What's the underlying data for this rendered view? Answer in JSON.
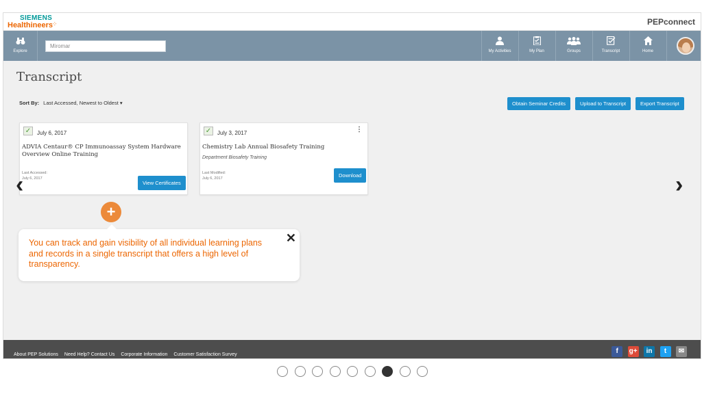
{
  "brand": {
    "company_line1": "SIEMENS",
    "company_line2": "Healthineers",
    "app_name": "PEPconnect"
  },
  "nav": {
    "explore_label": "Explore",
    "search_value": "Miromar",
    "items": [
      {
        "label": "My Activities",
        "icon": "person-icon"
      },
      {
        "label": "My Plan",
        "icon": "clipboard-icon"
      },
      {
        "label": "Groups",
        "icon": "group-icon"
      },
      {
        "label": "Transcript",
        "icon": "transcript-icon"
      },
      {
        "label": "Home",
        "icon": "home-icon"
      }
    ]
  },
  "page": {
    "title": "Transcript",
    "sort_label": "Sort By:",
    "sort_value": "Last Accessed, Newest to Oldest",
    "actions": [
      "Obtain Seminar Credits",
      "Upload to Transcript",
      "Export Transcript"
    ]
  },
  "cards": [
    {
      "date": "July 6, 2017",
      "title": "ADVIA Centaur® CP Immunoassay System Hardware Overview Online Training",
      "meta_label": "Last Accessed:",
      "meta_date": "July 6, 2017",
      "button": "View Certificates"
    },
    {
      "date": "July 3, 2017",
      "title": "Chemistry Lab Annual Biosafety Training",
      "subtitle": "Department Biosafety Training",
      "meta_label": "Last Modified:",
      "meta_date": "July 6, 2017",
      "button": "Download"
    }
  ],
  "tooltip": {
    "text": "You can track and gain visibility of all individual learning plans and records in a single transcript that offers a high level of transparency."
  },
  "footer": {
    "links": [
      "About PEP Solutions",
      "Need Help? Contact Us",
      "Corporate Information",
      "Customer Satisfaction Survey"
    ],
    "social": [
      "facebook-icon",
      "google-plus-icon",
      "linkedin-icon",
      "twitter-icon",
      "email-icon"
    ]
  },
  "pagination": {
    "total": 9,
    "active_index": 6
  },
  "colors": {
    "accent": "#ec6602",
    "nav_bg": "#7b93a6",
    "button": "#1e8fcd",
    "footer_bg": "#4d4d4d"
  }
}
